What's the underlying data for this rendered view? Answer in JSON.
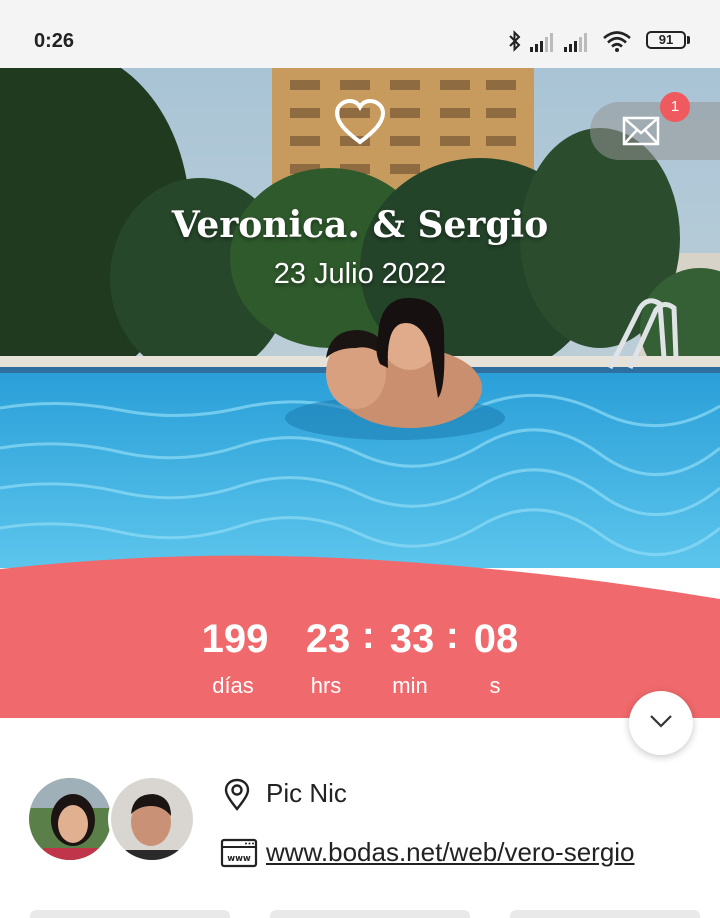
{
  "status_bar": {
    "time": "0:26",
    "battery": "91",
    "icons": [
      "bluetooth-icon",
      "signal-icon",
      "signal-icon",
      "wifi-icon",
      "battery-icon"
    ]
  },
  "hero": {
    "couple_names": "Veronica. & Sergio",
    "date": "23 Julio 2022",
    "notification_count": "1",
    "icons": [
      "heart-icon",
      "envelope-icon"
    ]
  },
  "countdown": {
    "days": "199",
    "hours": "23",
    "minutes": "33",
    "seconds": "08",
    "separator": ":",
    "labels": {
      "days": "días",
      "hours": "hrs",
      "minutes": "min",
      "seconds": "s"
    }
  },
  "info": {
    "location": "Pic Nic",
    "website": "www.bodas.net/web/vero-sergio",
    "icons": [
      "map-pin-icon",
      "www-icon",
      "chevron-down-icon"
    ]
  },
  "colors": {
    "accent": "#ef6b6e",
    "status_bar_bg": "#f4f4f4",
    "badge": "#ef5a5f"
  }
}
